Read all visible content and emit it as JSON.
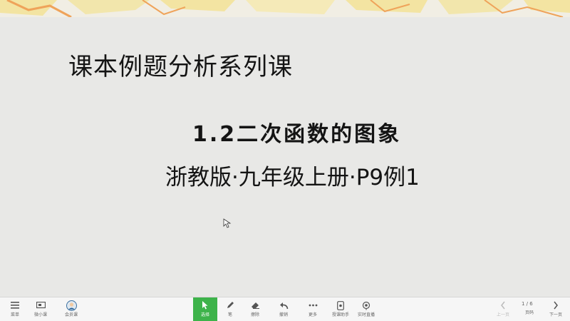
{
  "slide": {
    "heading": "课本例题分析系列课",
    "subtitle": "1.2二次函数的图象",
    "edition": "浙教版·九年级上册·P9例1"
  },
  "toolbar": {
    "menu_label": "菜单",
    "mini_class_label": "微小课",
    "speaker_label": "会员课",
    "select_label": "选择",
    "pen_label": "笔",
    "eraser_label": "擦除",
    "undo_label": "撤销",
    "more_label": "更多",
    "assistant_label": "授课助手",
    "live_label": "实时直播",
    "prev_label": "上一页",
    "page_counter": "1 / 6",
    "pages_label": "页码",
    "next_label": "下一页"
  },
  "colors": {
    "active_tool": "#3db34a",
    "pattern_yellow": "#f3e4a2",
    "pattern_orange": "#efa35a"
  }
}
